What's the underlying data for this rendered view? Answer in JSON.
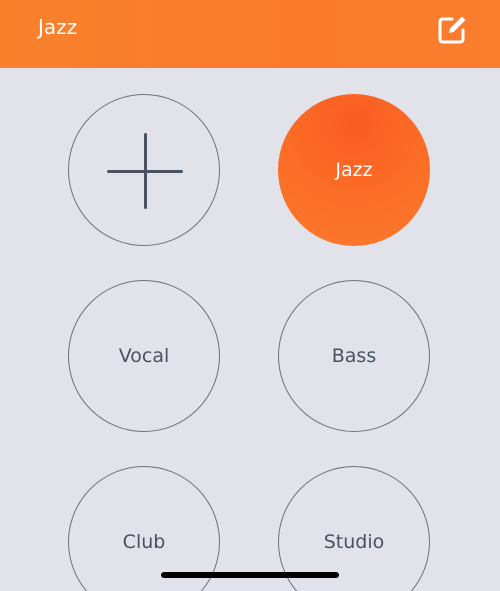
{
  "header": {
    "title": "Jazz",
    "edit_icon": "edit-icon",
    "background": "#fa7b2b"
  },
  "presets": [
    {
      "label": "",
      "icon": "plus-icon",
      "active": false
    },
    {
      "label": "Jazz",
      "active": true
    },
    {
      "label": "Vocal",
      "active": false
    },
    {
      "label": "Bass",
      "active": false
    },
    {
      "label": "Club",
      "active": false
    },
    {
      "label": "Studio",
      "active": false
    }
  ],
  "colors": {
    "accent": "#fa6a25",
    "background": "#e1e2ea",
    "outline": "#6d727c",
    "text": "#495260"
  }
}
